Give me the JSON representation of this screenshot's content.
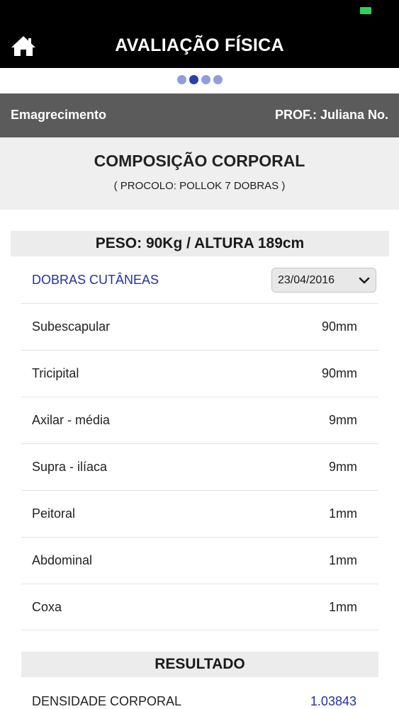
{
  "header": {
    "title": "AVALIAÇÃO FÍSICA",
    "home_icon": "home-icon",
    "battery_color": "#31d158"
  },
  "pager": {
    "count": 4,
    "active_index": 1,
    "active_color": "#2a3fa8",
    "inactive_color": "#8f9de0"
  },
  "infobar": {
    "goal": "Emagrecimento",
    "professor": "PROF.: Juliana No."
  },
  "section": {
    "title": "COMPOSIÇÃO CORPORAL",
    "subtitle": "( PROCOLO: POLLOK 7 DOBRAS )"
  },
  "measures": {
    "label": "PESO: 90Kg / ALTURA 189cm"
  },
  "skinfolds": {
    "label": "DOBRAS CUTÂNEAS",
    "date": "23/04/2016",
    "rows": [
      {
        "label": "Subescapular",
        "value": "90mm"
      },
      {
        "label": "Tricipital",
        "value": "90mm"
      },
      {
        "label": "Axilar - média",
        "value": "9mm"
      },
      {
        "label": "Supra - ilíaca",
        "value": "9mm"
      },
      {
        "label": "Peitoral",
        "value": "1mm"
      },
      {
        "label": "Abdominal",
        "value": "1mm"
      },
      {
        "label": "Coxa",
        "value": "1mm"
      }
    ]
  },
  "result": {
    "label": "RESULTADO",
    "density_label": "DENSIDADE CORPORAL",
    "density_value": "1.03843"
  },
  "colors": {
    "accent": "#2233a0",
    "topbar": "#000000",
    "infobar": "#5b5b5b"
  }
}
